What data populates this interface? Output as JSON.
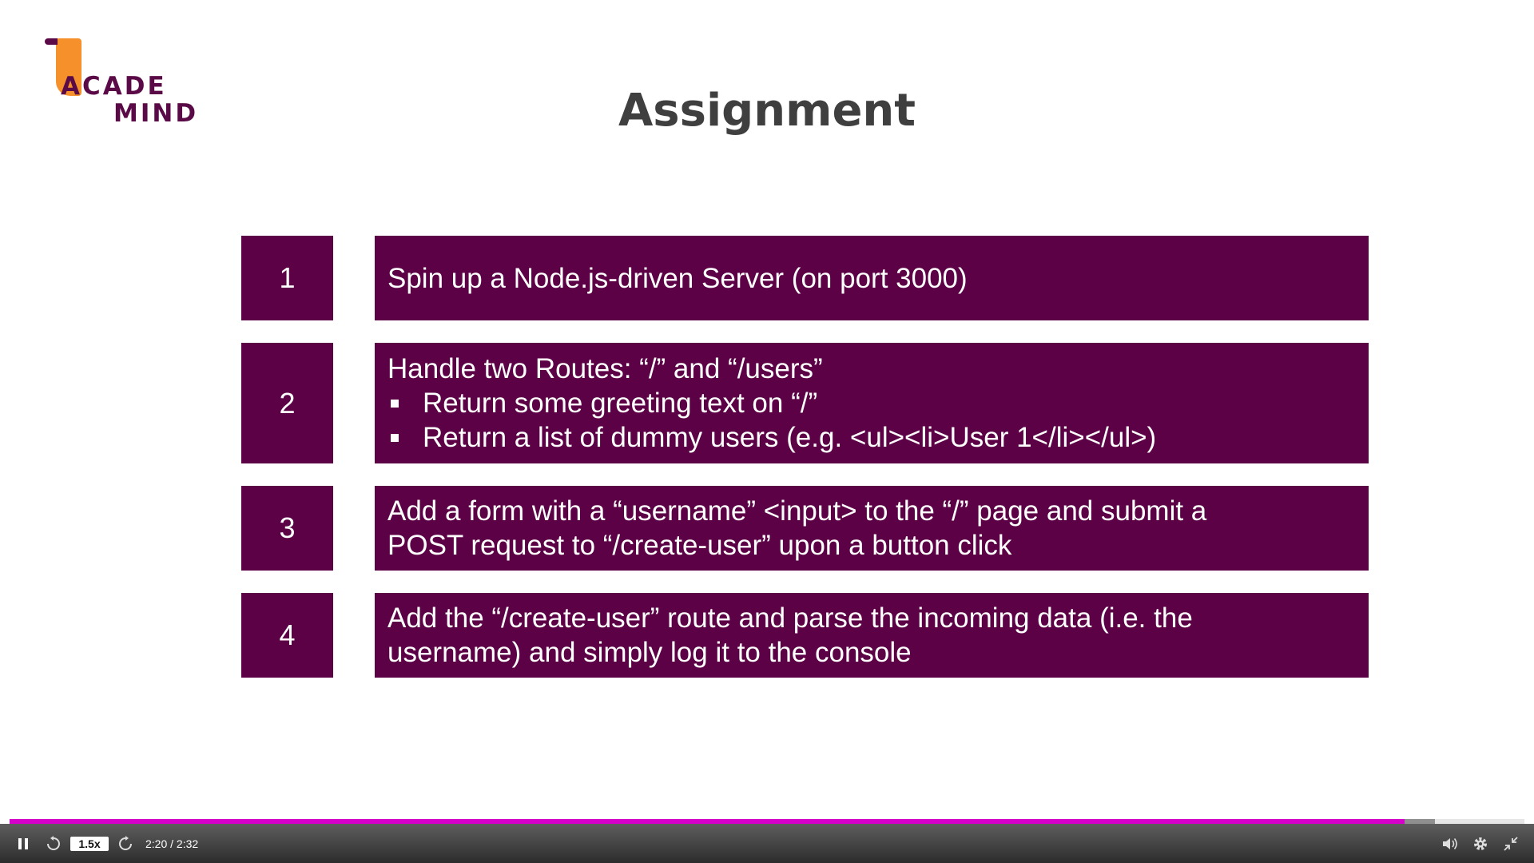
{
  "logo": {
    "line1": "ACADE",
    "line2": "MIND"
  },
  "slide": {
    "title": "Assignment",
    "steps": [
      {
        "number": "1",
        "lines": [
          "Spin up a Node.js-driven Server (on port 3000)"
        ],
        "bullets": []
      },
      {
        "number": "2",
        "lines": [
          "Handle two Routes: “/” and “/users”"
        ],
        "bullets": [
          "Return some greeting text on “/”",
          "Return a list of dummy users (e.g. <ul><li>User 1</li></ul>)"
        ]
      },
      {
        "number": "3",
        "lines": [
          "Add a form with a “username” <input> to the “/” page and submit a",
          "POST request to “/create-user” upon a button click"
        ],
        "bullets": []
      },
      {
        "number": "4",
        "lines": [
          "Add the “/create-user” route and parse the incoming data (i.e. the",
          "username) and simply log it to the console"
        ],
        "bullets": []
      }
    ]
  },
  "player": {
    "speed": "1.5x",
    "time": "2:20 / 2:32",
    "progress_fraction": 0.921,
    "buffered_fraction": 0.941,
    "icons": [
      "pause-icon",
      "rewind-icon",
      "forward-icon",
      "volume-icon",
      "settings-icon",
      "exit-fullscreen-icon"
    ],
    "accent_color": "#d500c9",
    "box_color": "#5c0146"
  }
}
